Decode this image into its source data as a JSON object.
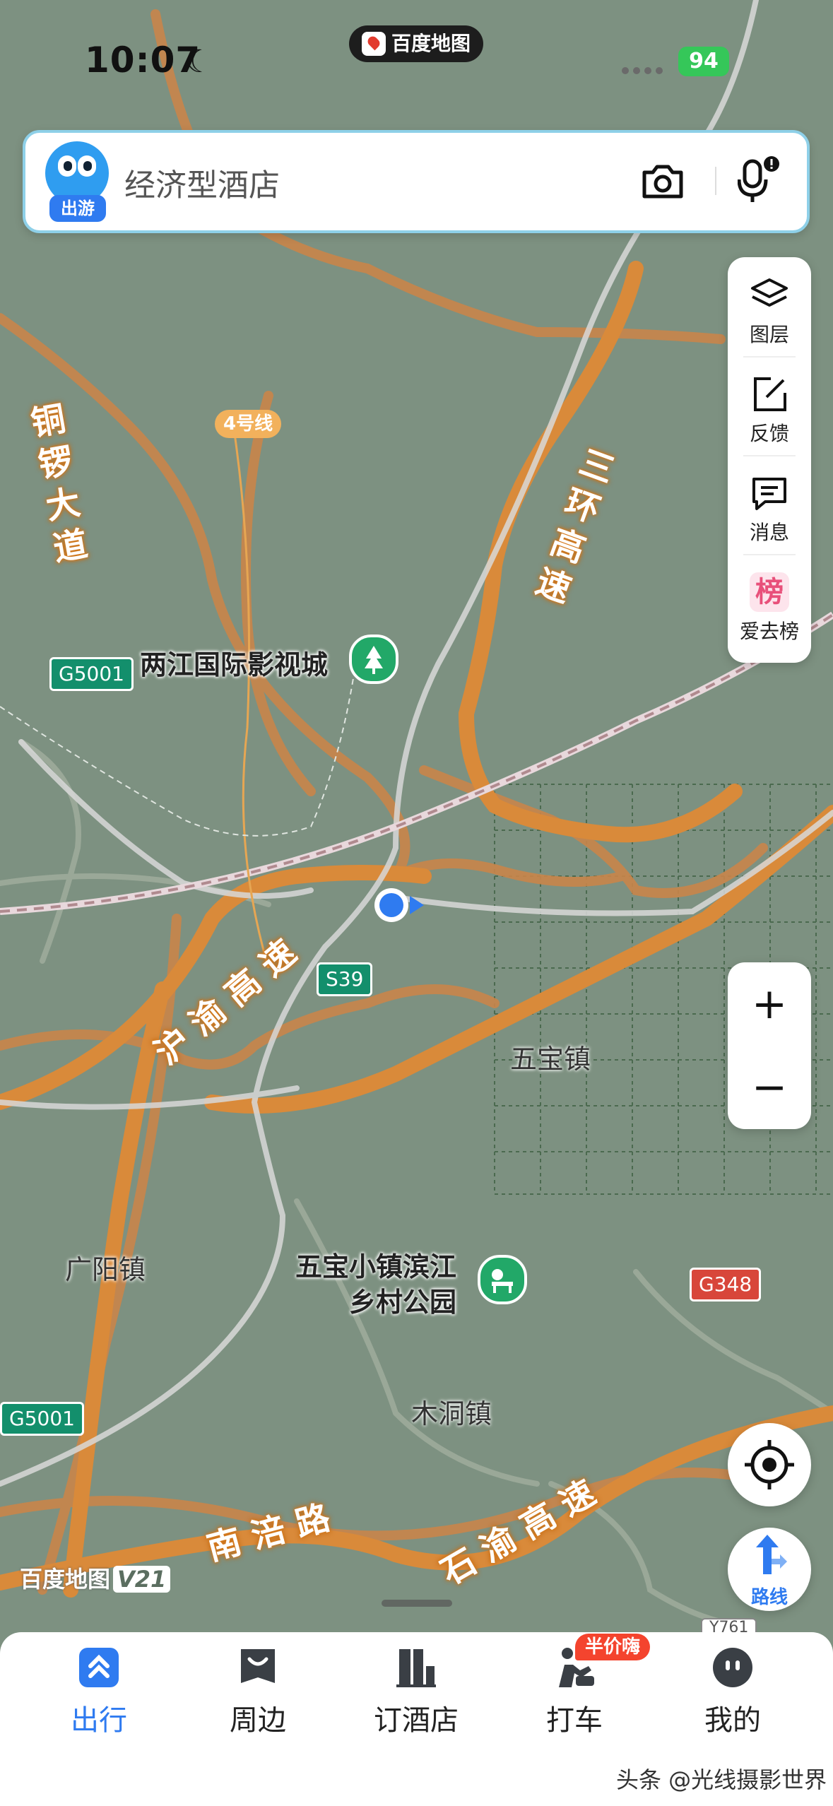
{
  "status_bar": {
    "time": "10:07",
    "app_name": "百度地图",
    "battery": "94"
  },
  "search": {
    "mascot_badge": "出游",
    "placeholder": "经济型酒店"
  },
  "tools": [
    {
      "label": "图层",
      "icon": "layers-icon"
    },
    {
      "label": "反馈",
      "icon": "feedback-icon"
    },
    {
      "label": "消息",
      "icon": "message-icon"
    },
    {
      "label": "爱去榜",
      "icon": "ranking-icon",
      "glyph": "榜"
    }
  ],
  "zoom": {
    "in": "+",
    "out": "−"
  },
  "route_label": "路线",
  "map": {
    "roads": {
      "tongluo": [
        "铜",
        "锣",
        "大",
        "道"
      ],
      "sanhuan": [
        "三",
        "环",
        "高",
        "速"
      ],
      "huyu": [
        "沪",
        "渝",
        "高",
        "速"
      ],
      "nanfu": [
        "南",
        "涪",
        "路"
      ],
      "shiyu": [
        "石",
        "渝",
        "高",
        "速"
      ]
    },
    "line4": "4号线",
    "shields": {
      "g5001_a": "G5001",
      "s39": "S39",
      "g348": "G348",
      "g5001_b": "G5001",
      "y761": "Y761"
    },
    "pois": {
      "film_city": "两江国际影视城",
      "park_line1": "五宝小镇滨江",
      "park_line2": "乡村公园"
    },
    "towns": {
      "wubao": "五宝镇",
      "guangyang": "广阳镇",
      "mudong": "木洞镇"
    },
    "watermark": "百度地图",
    "watermark_version": "V21"
  },
  "bottom_nav": {
    "items": [
      {
        "label": "出行",
        "active": true
      },
      {
        "label": "周边",
        "active": false
      },
      {
        "label": "订酒店",
        "active": false
      },
      {
        "label": "打车",
        "active": false
      },
      {
        "label": "我的",
        "active": false
      }
    ],
    "taxi_badge": "半价嗨"
  },
  "credit": "头条 @光线摄影世界",
  "colors": {
    "accent": "#2f7bf0",
    "highway": "#d98a3a",
    "map_bg": "#7d9181",
    "park_green": "#22a868"
  }
}
